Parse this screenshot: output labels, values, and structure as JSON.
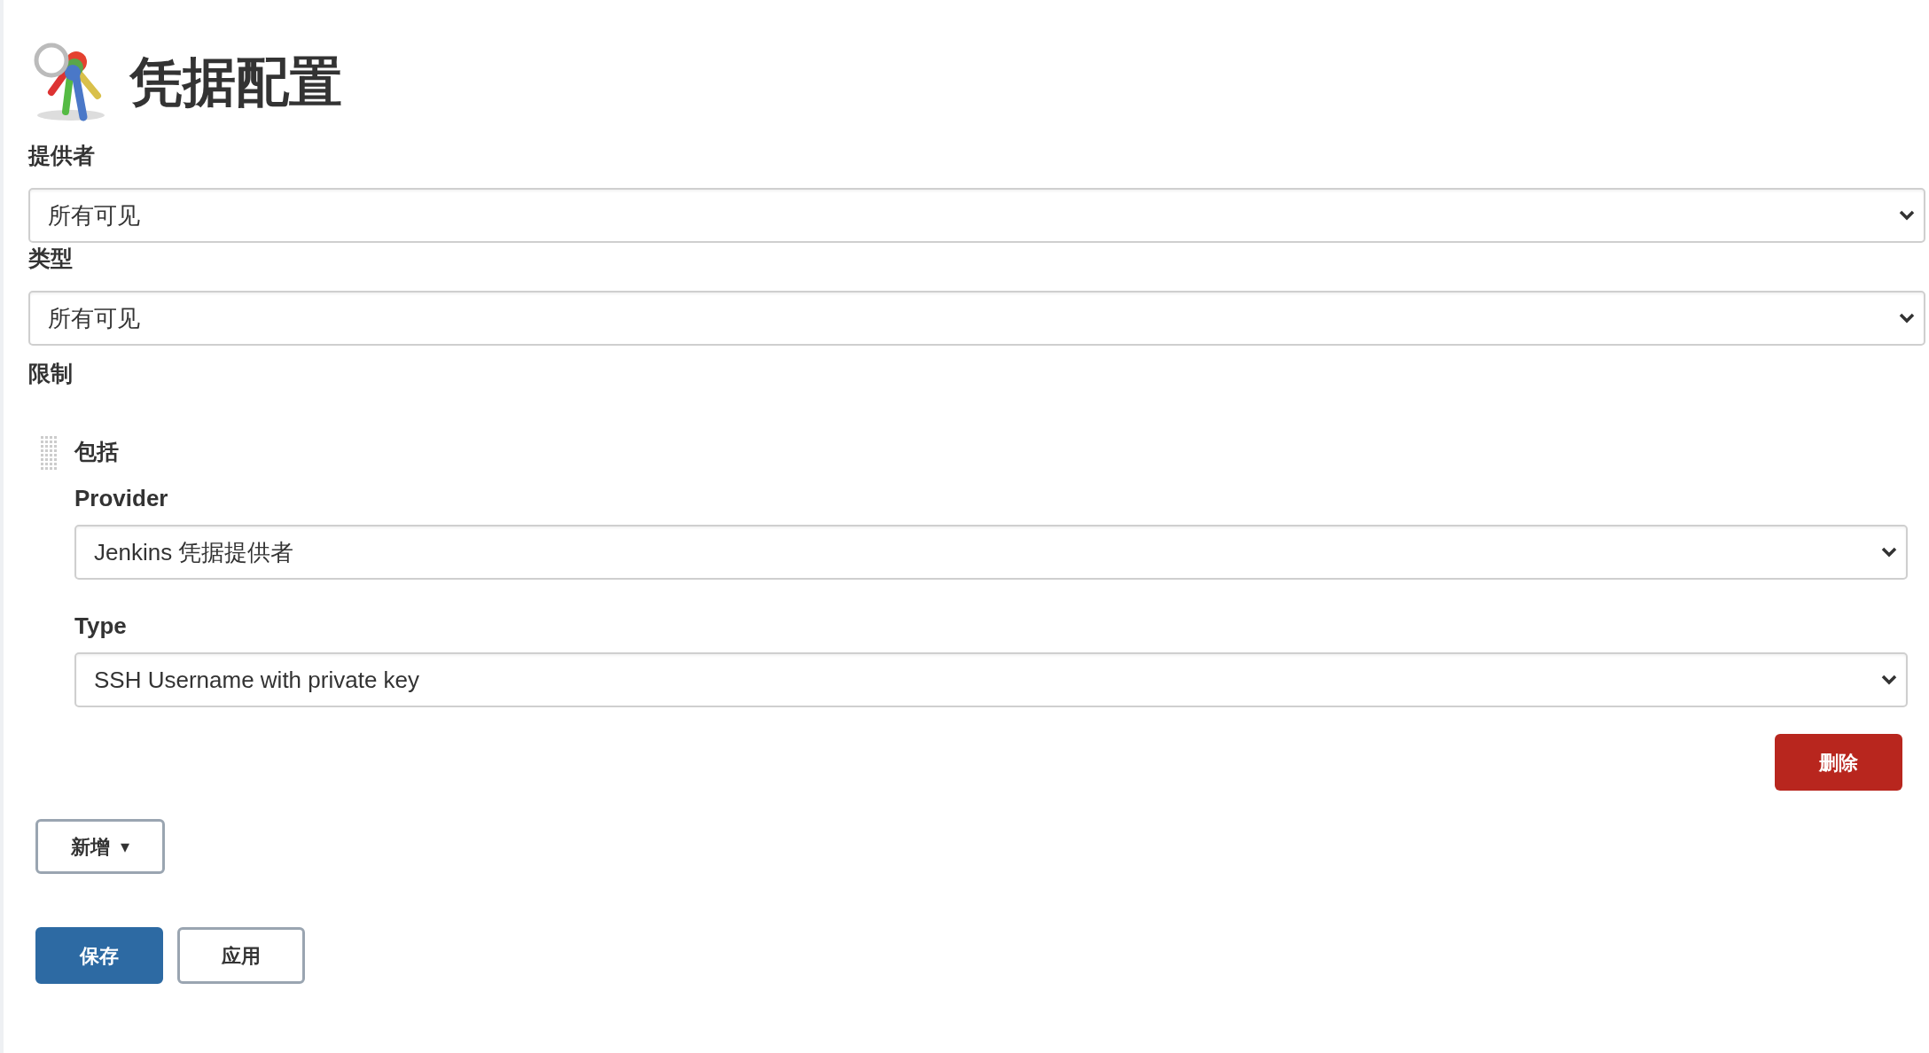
{
  "title": "凭据配置",
  "fields": [
    {
      "label": "提供者",
      "value": "所有可见"
    },
    {
      "label": "类型",
      "value": "所有可见"
    }
  ],
  "restriction": {
    "label": "限制",
    "item": {
      "title": "包括",
      "fields": [
        {
          "label": "Provider",
          "value": "Jenkins 凭据提供者"
        },
        {
          "label": "Type",
          "value": "SSH Username with private key"
        }
      ],
      "delete_button": "删除"
    }
  },
  "add_button": {
    "label": "新增",
    "caret": "▾"
  },
  "buttons": [
    {
      "label": "保存",
      "kind": "primary"
    },
    {
      "label": "应用",
      "kind": "secondary"
    }
  ]
}
